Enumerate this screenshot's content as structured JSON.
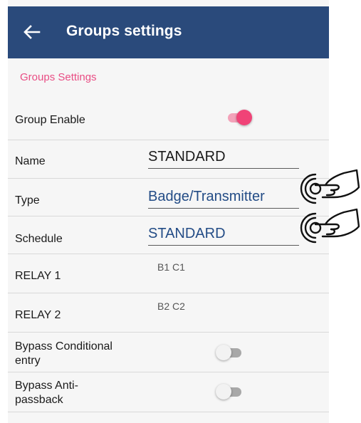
{
  "appbar": {
    "title": "Groups settings"
  },
  "section_label": "Groups Settings",
  "rows": {
    "group_enable": {
      "label": "Group Enable",
      "enabled": true
    },
    "name": {
      "label": "Name",
      "value": "STANDARD"
    },
    "type": {
      "label": "Type",
      "value": "Badge/Transmitter"
    },
    "schedule": {
      "label": "Schedule",
      "value": "STANDARD"
    },
    "relay1": {
      "label": "RELAY 1",
      "value": "B1 C1"
    },
    "relay2": {
      "label": "RELAY 2",
      "value": "B2 C2"
    },
    "bypass_conditional": {
      "label_line1": "Bypass Conditional",
      "label_line2": "entry",
      "enabled": false
    },
    "bypass_antipassback": {
      "label_line1": "Bypass Anti-",
      "label_line2": "passback",
      "enabled": false
    }
  },
  "colors": {
    "appbar": "#2a4a7b",
    "accent": "#f04377",
    "section_label": "#e94d84",
    "link_value": "#234c86"
  },
  "icons": {
    "back": "arrow-left-icon",
    "tap": "tap-gesture-icon"
  }
}
